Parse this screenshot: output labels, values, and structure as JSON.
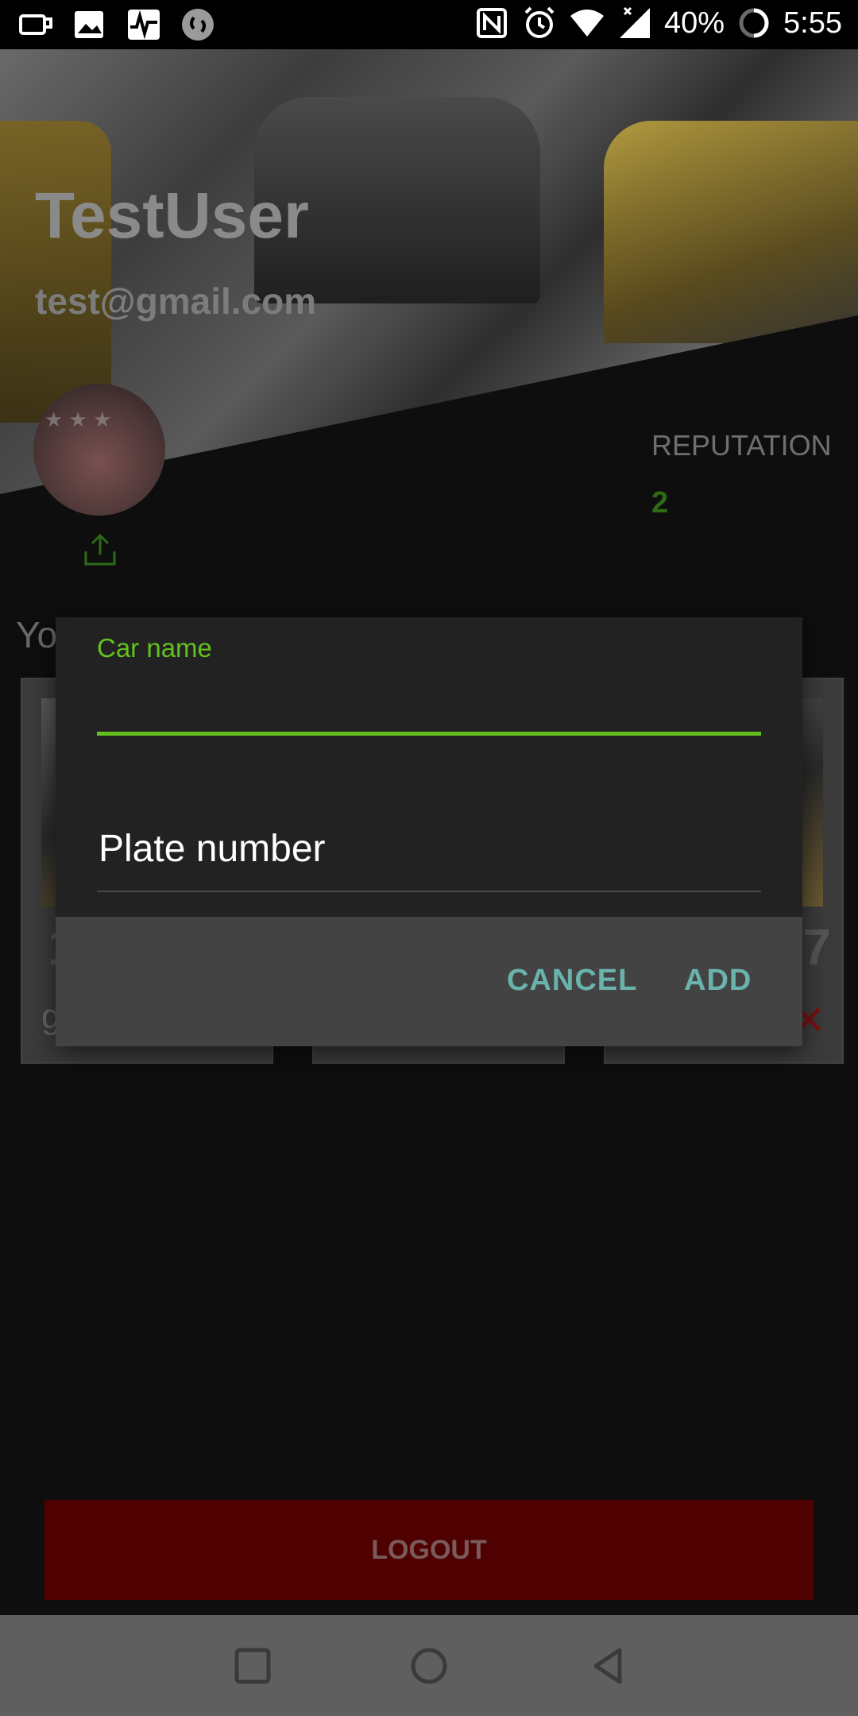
{
  "status_bar": {
    "battery": "40%",
    "time": "5:55"
  },
  "profile": {
    "username": "TestUser",
    "email": "test@gmail.com",
    "reputation_label": "REPUTATION",
    "reputation_value": "2"
  },
  "cars_section": {
    "title": "Yo",
    "cards": [
      {
        "number": "1",
        "sub": "g"
      },
      {
        "number": "",
        "sub": ""
      },
      {
        "number": "7",
        "sub": ""
      }
    ]
  },
  "dialog": {
    "car_name_label": "Car name",
    "car_name_value": "",
    "plate_placeholder": "Plate number",
    "cancel_label": "CANCEL",
    "add_label": "ADD"
  },
  "logout_label": "LOGOUT",
  "colors": {
    "accent_green": "#62c11e",
    "button_teal": "#6ab3ac",
    "logout_red": "#4f0000"
  }
}
